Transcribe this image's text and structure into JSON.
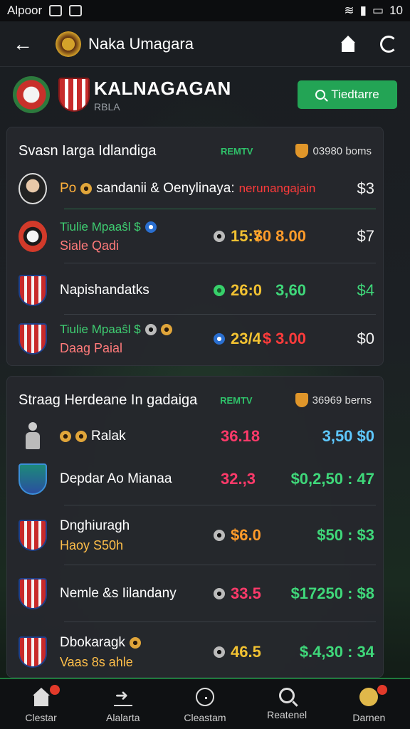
{
  "status_bar": {
    "carrier": "Alpoor",
    "time": "10"
  },
  "app_bar": {
    "title": "Naka Umagara"
  },
  "team": {
    "name": "KALNAGAGAN",
    "subtitle": "RBLA",
    "follow_label": "Tiedtarre"
  },
  "card1": {
    "title": "Svasn Iarga Idlandiga",
    "tag": "REMTV",
    "right_text": "03980 boms",
    "rows": [
      {
        "label_a": "Po",
        "label_b": "sandanii & Oenylinaya:",
        "label_red": "nerunangajain",
        "end": "$3"
      },
      {
        "top": "Tiulie Mpaaŝl $",
        "label": "Siale Qadi",
        "time": "15:7",
        "price": "$0 8.00",
        "end": "$7"
      },
      {
        "label": "Napishandatks",
        "time": "26:0",
        "price": "3,60",
        "end": "$4"
      },
      {
        "top": "Tiulie Mpaaŝl $",
        "label": "Daag Paial",
        "time": "23/4",
        "price": "$ 3.00",
        "end": "$0"
      }
    ]
  },
  "card2": {
    "title": "Straag Herdeane In gadaiga",
    "tag": "REMTV",
    "right_text": "36969 berns",
    "rows": [
      {
        "label": "Ralak",
        "time": "36.18",
        "price": "3,50 $0",
        "end": ""
      },
      {
        "label": "Depdar Ao Mianaa",
        "time": "32.,3",
        "price": "$0,2,50 : 47",
        "end": ""
      },
      {
        "label": "Dnghiuragh",
        "sub": "Haoy S50h",
        "time": "$6.0",
        "price": "$50 : $3",
        "end": ""
      },
      {
        "label": "Nemle &s Iilandany",
        "time": "33.5",
        "price": "$17250 : $8",
        "end": ""
      },
      {
        "label": "Dbokaragk",
        "sub": "Vaas 8s ahle",
        "time": "46.5",
        "price": "$.4,30 : 34",
        "end": ""
      }
    ]
  },
  "bottom_nav": [
    {
      "label": "Clestar",
      "icon": "home-icon"
    },
    {
      "label": "Alalarta",
      "icon": "share-icon"
    },
    {
      "label": "Cleastam",
      "icon": "clock-icon"
    },
    {
      "label": "Reatenel",
      "icon": "search-icon"
    },
    {
      "label": "Darnen",
      "icon": "user-icon"
    }
  ]
}
